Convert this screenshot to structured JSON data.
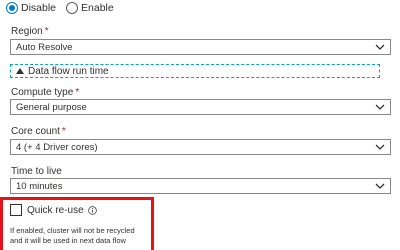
{
  "radio": {
    "options": [
      "Disable",
      "Enable"
    ],
    "selected": "Disable"
  },
  "region": {
    "label": "Region",
    "required_mark": "*",
    "value": "Auto Resolve"
  },
  "section_toggle": {
    "label": "Data flow run time"
  },
  "compute_type": {
    "label": "Compute type",
    "required_mark": "*",
    "value": "General purpose"
  },
  "core_count": {
    "label": "Core count",
    "required_mark": "*",
    "value": "4 (+ 4 Driver cores)"
  },
  "time_to_live": {
    "label": "Time to live",
    "value": "10 minutes"
  },
  "quick_reuse": {
    "label": "Quick re-use",
    "checked": false,
    "tooltip_lines": [
      "If enabled, cluster will not be recycled",
      "and it will be used in next data flow"
    ]
  },
  "colors": {
    "accent": "#0078d4",
    "highlight_border": "#e3121b",
    "required": "#a4262c",
    "section_border": "#00a2d0"
  },
  "icons": {
    "dropdown": "chevron-down-icon",
    "section": "triangle-up-icon",
    "info": "info-icon"
  }
}
